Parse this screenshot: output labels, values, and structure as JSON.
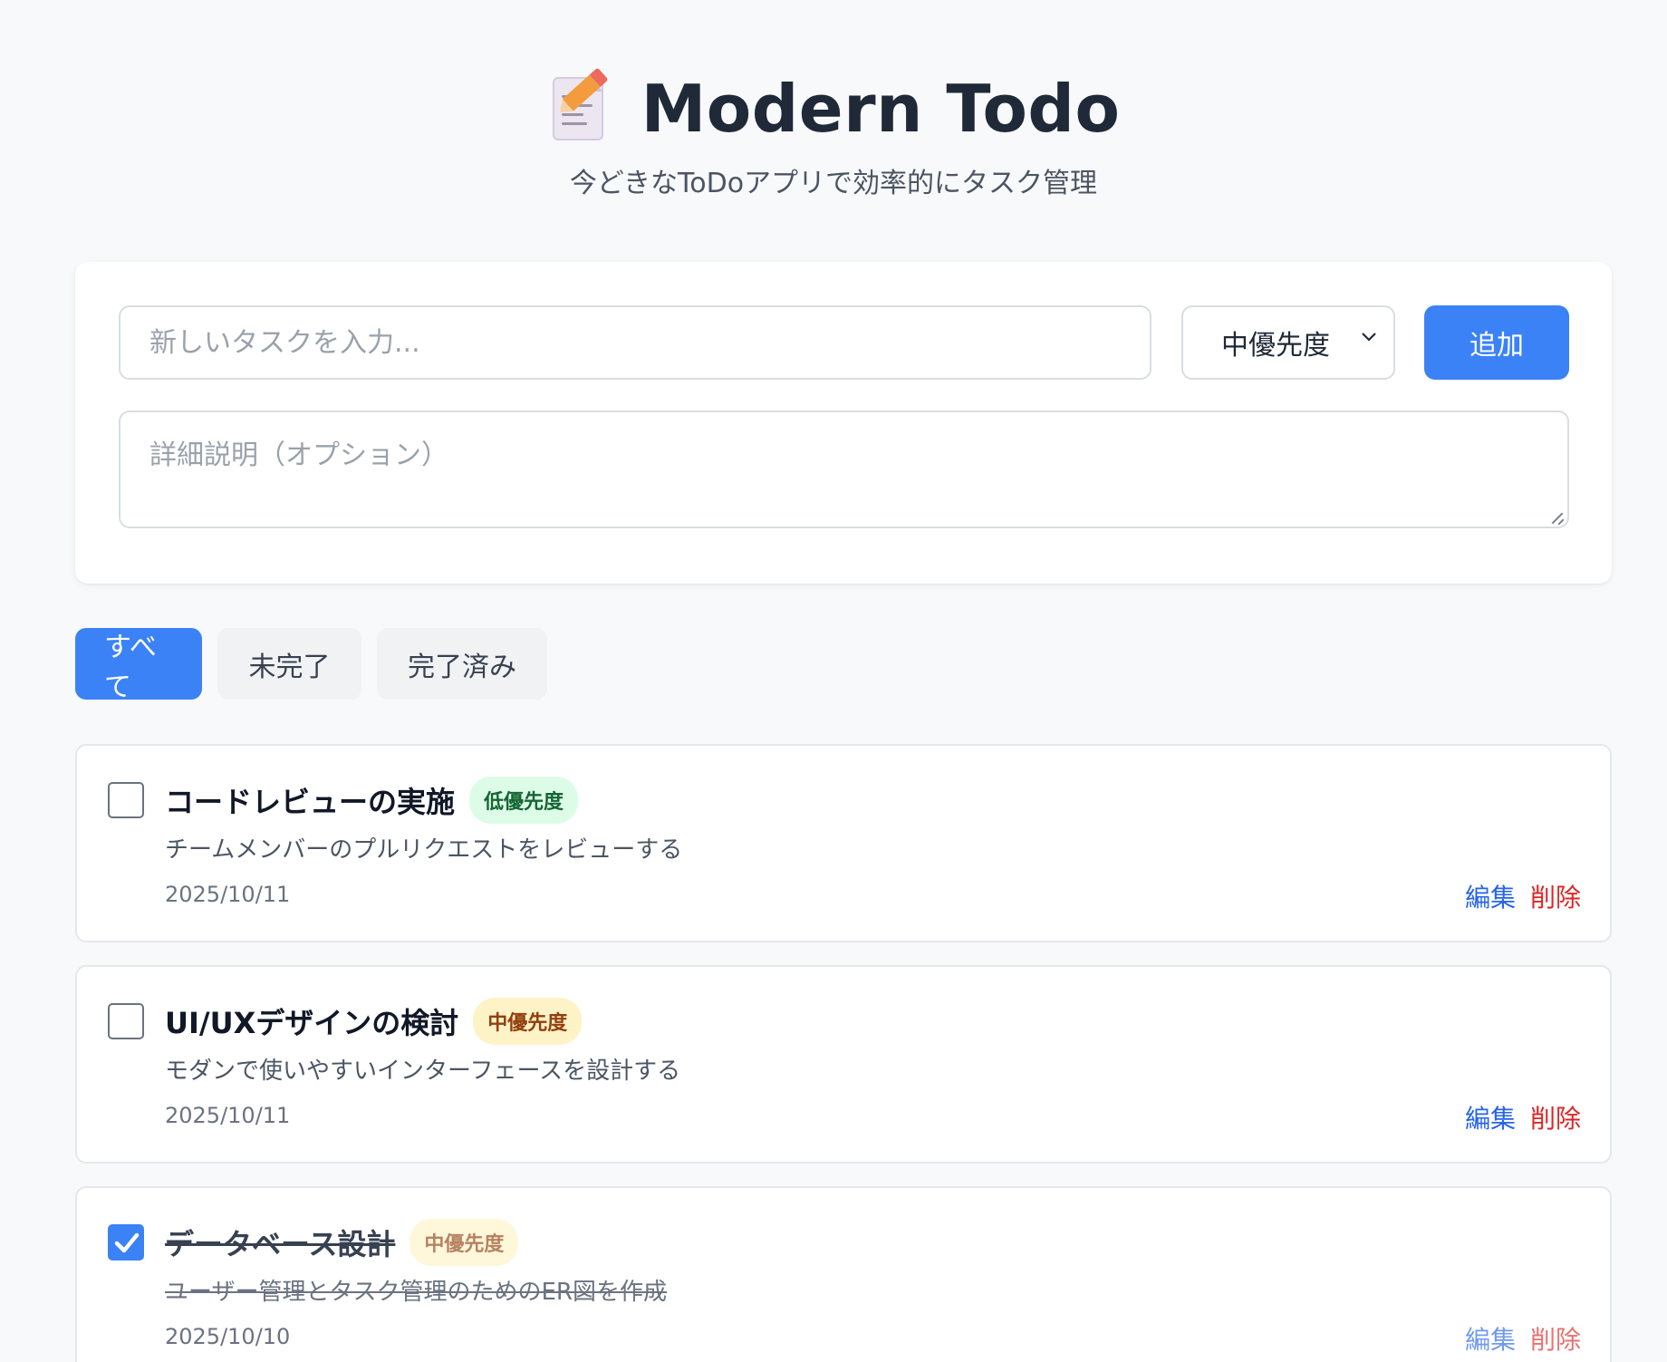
{
  "header": {
    "title": "Modern Todo",
    "subtitle": "今どきなToDoアプリで効率的にタスク管理",
    "icon": "memo-icon"
  },
  "form": {
    "task_placeholder": "新しいタスクを入力...",
    "priority_value": "中優先度",
    "add_label": "追加",
    "desc_placeholder": "詳細説明（オプション）"
  },
  "filters": [
    {
      "label": "すべて",
      "active": true
    },
    {
      "label": "未完了",
      "active": false
    },
    {
      "label": "完了済み",
      "active": false
    }
  ],
  "tasks": [
    {
      "title": "コードレビューの実施",
      "priority": "低優先度",
      "description": "チームメンバーのプルリクエストをレビューする",
      "date": "2025/10/11",
      "completed": false,
      "edit_label": "編集",
      "delete_label": "削除"
    },
    {
      "title": "UI/UXデザインの検討",
      "priority": "中優先度",
      "description": "モダンで使いやすいインターフェースを設計する",
      "date": "2025/10/11",
      "completed": false,
      "edit_label": "編集",
      "delete_label": "削除"
    },
    {
      "title": "データベース設計",
      "priority": "中優先度",
      "description": "ユーザー管理とタスク管理のためのER図を作成",
      "date": "2025/10/10",
      "completed": true,
      "edit_label": "編集",
      "delete_label": "削除"
    }
  ],
  "colors": {
    "accent": "#3b82f6",
    "low_badge_bg": "#dcfce7",
    "mid_badge_bg": "#fef3c7",
    "delete": "#dc2626"
  }
}
